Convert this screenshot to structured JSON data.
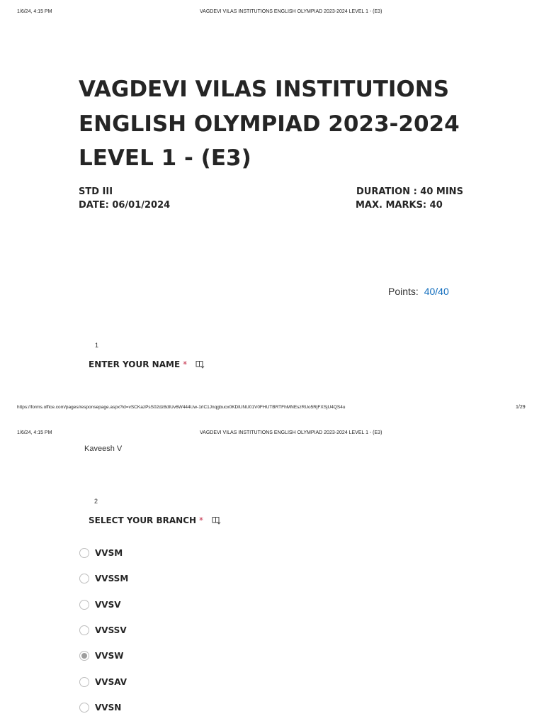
{
  "page1": {
    "header": {
      "datetime": "1/6/24, 4:15 PM",
      "doc_title": "VAGDEVI VILAS INSTITUTIONS ENGLISH OLYMPIAD  2023-2024 LEVEL 1 - (E3)"
    },
    "form": {
      "title_lines": [
        "VAGDEVI VILAS INSTITUTIONS",
        "ENGLISH OLYMPIAD  2023-2024",
        "LEVEL 1 - (E3)"
      ],
      "std": "STD III",
      "date": "DATE:  06/01/2024",
      "duration": "DURATION : 40 MINS",
      "max_marks": "MAX. MARKS: 40"
    },
    "points": {
      "label": "Points:",
      "value": "40/40"
    },
    "question1": {
      "number": "1",
      "title": "ENTER YOUR NAME",
      "required_mark": "*"
    },
    "footer": {
      "url": "https://forms.office.com/pages/responsepage.aspx?id=vSCKazPsS02dz8dIUv6W444Uw-1rlC1Jnqgbucx0KDlUNU01V0FHUTBRTFhMNEszRUo5RjFXSjU4QS4u",
      "page": "1/29"
    }
  },
  "page2": {
    "header": {
      "datetime": "1/6/24, 4:15 PM",
      "doc_title": "VAGDEVI VILAS INSTITUTIONS ENGLISH OLYMPIAD  2023-2024 LEVEL 1 - (E3)"
    },
    "question1_answer": "Kaveesh V",
    "question2": {
      "number": "2",
      "title": "SELECT YOUR BRANCH",
      "required_mark": "*",
      "options": [
        {
          "label": "VVSM",
          "selected": false
        },
        {
          "label": "VVSSM",
          "selected": false
        },
        {
          "label": "VVSV",
          "selected": false
        },
        {
          "label": "VVSSV",
          "selected": false
        },
        {
          "label": "VVSW",
          "selected": true
        },
        {
          "label": "VVSAV",
          "selected": false
        },
        {
          "label": "VVSN",
          "selected": false
        }
      ]
    }
  },
  "colors": {
    "accent": "#0f6cbd",
    "required": "#c4314b",
    "selected_radio": "#9e9e9e"
  },
  "icons": {
    "question_action": "immersive-reader-icon"
  }
}
